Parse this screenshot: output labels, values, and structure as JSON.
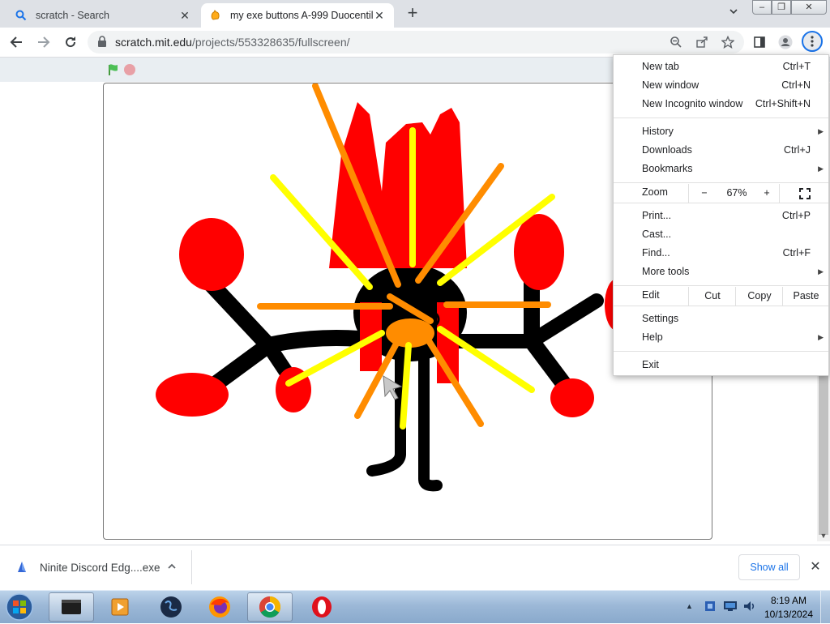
{
  "browser": {
    "tabs": [
      {
        "title": "scratch - Search",
        "icon": "search-icon"
      },
      {
        "title": "my exe buttons A-999 Duocentill",
        "icon": "scratch-cat-icon",
        "active": true
      }
    ],
    "url_host": "scratch.mit.edu",
    "url_path": "/projects/553328635/fullscreen/"
  },
  "menu": {
    "items": [
      {
        "label": "New tab",
        "shortcut": "Ctrl+T"
      },
      {
        "label": "New window",
        "shortcut": "Ctrl+N"
      },
      {
        "label": "New Incognito window",
        "shortcut": "Ctrl+Shift+N"
      },
      {
        "label": "History",
        "shortcut": ""
      },
      {
        "label": "Downloads",
        "shortcut": "Ctrl+J"
      },
      {
        "label": "Bookmarks",
        "shortcut": ""
      },
      {
        "label": "Print...",
        "shortcut": "Ctrl+P"
      },
      {
        "label": "Cast...",
        "shortcut": ""
      },
      {
        "label": "Find...",
        "shortcut": "Ctrl+F"
      },
      {
        "label": "More tools",
        "shortcut": ""
      },
      {
        "label": "Settings",
        "shortcut": ""
      },
      {
        "label": "Help",
        "shortcut": ""
      },
      {
        "label": "Exit",
        "shortcut": ""
      }
    ],
    "zoom": {
      "label": "Zoom",
      "minus": "−",
      "value": "67%",
      "plus": "+"
    },
    "edit": {
      "label": "Edit",
      "cut": "Cut",
      "copy": "Copy",
      "paste": "Paste"
    }
  },
  "download": {
    "filename": "Ninite Discord Edg....exe",
    "show_all": "Show all"
  },
  "taskbar": {
    "time": "8:19 AM",
    "date": "10/13/2024"
  },
  "colors": {
    "accent": "#1a73e8",
    "drawing_red": "#ff0000",
    "drawing_orange": "#ff8c00",
    "drawing_yellow": "#ffff00",
    "drawing_black": "#000000"
  }
}
